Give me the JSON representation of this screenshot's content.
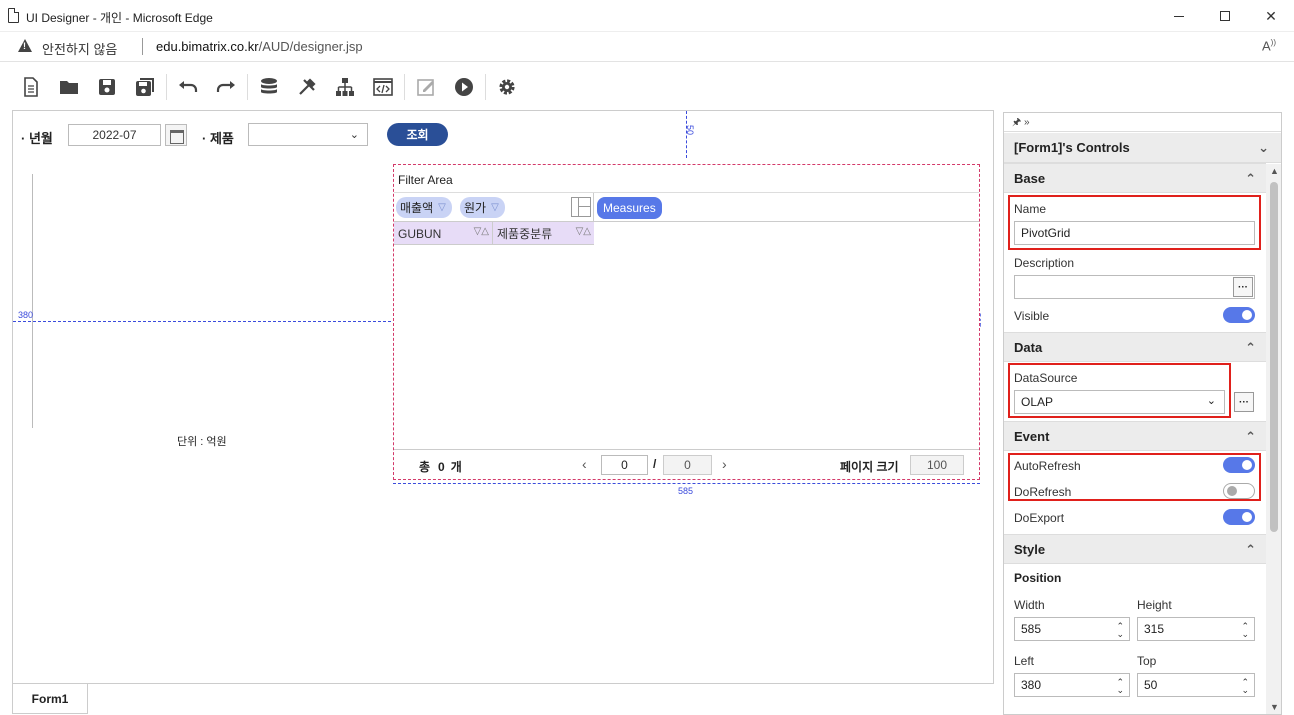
{
  "window": {
    "title": "UI Designer - 개인 - Microsoft Edge",
    "insecure_label": "안전하지 않음",
    "url_host": "edu.bimatrix.co.kr",
    "url_path": "/AUD/designer.jsp"
  },
  "toolbar": {
    "icons": [
      "new-file-icon",
      "open-folder-icon",
      "save-icon",
      "save-all-icon",
      "undo-icon",
      "redo-icon",
      "database-icon",
      "tools-icon",
      "hierarchy-icon",
      "code-icon",
      "edit-icon",
      "run-icon",
      "settings-icon"
    ]
  },
  "form": {
    "year_month_label": "· 년월",
    "year_month_value": "2022-07",
    "product_label": "· 제품",
    "product_value": "",
    "query_button": "조회",
    "unit_label": "단위 : 억원",
    "guide_left": "380",
    "guide_top": "50",
    "guide_width": "585",
    "guide_height": "315"
  },
  "pivot": {
    "filter_area": "Filter Area",
    "data_fields": [
      "매출액",
      "원가"
    ],
    "measures": "Measures",
    "row_fields": [
      "GUBUN",
      "제품중분류"
    ],
    "footer": {
      "total_label": "총",
      "total_count": "0",
      "total_unit": "개",
      "page_current": "0",
      "page_slash": "/",
      "page_total": "0",
      "page_size_label": "페이지 크기",
      "page_size": "100"
    }
  },
  "panel": {
    "title": "[Form1]'s Controls",
    "top_icons": "🖈 »",
    "sections": {
      "base": "Base",
      "data": "Data",
      "event": "Event",
      "style": "Style"
    },
    "name_label": "Name",
    "name_value": "PivotGrid",
    "description_label": "Description",
    "description_value": "",
    "visible_label": "Visible",
    "visible": true,
    "datasource_label": "DataSource",
    "datasource_value": "OLAP",
    "auto_refresh_label": "AutoRefresh",
    "auto_refresh": true,
    "do_refresh_label": "DoRefresh",
    "do_refresh": false,
    "do_export_label": "DoExport",
    "do_export": true,
    "position_label": "Position",
    "width_label": "Width",
    "width_value": "585",
    "height_label": "Height",
    "height_value": "315",
    "left_label": "Left",
    "left_value": "380",
    "top_label": "Top",
    "top_value": "50"
  },
  "tabs": {
    "form1": "Form1"
  }
}
